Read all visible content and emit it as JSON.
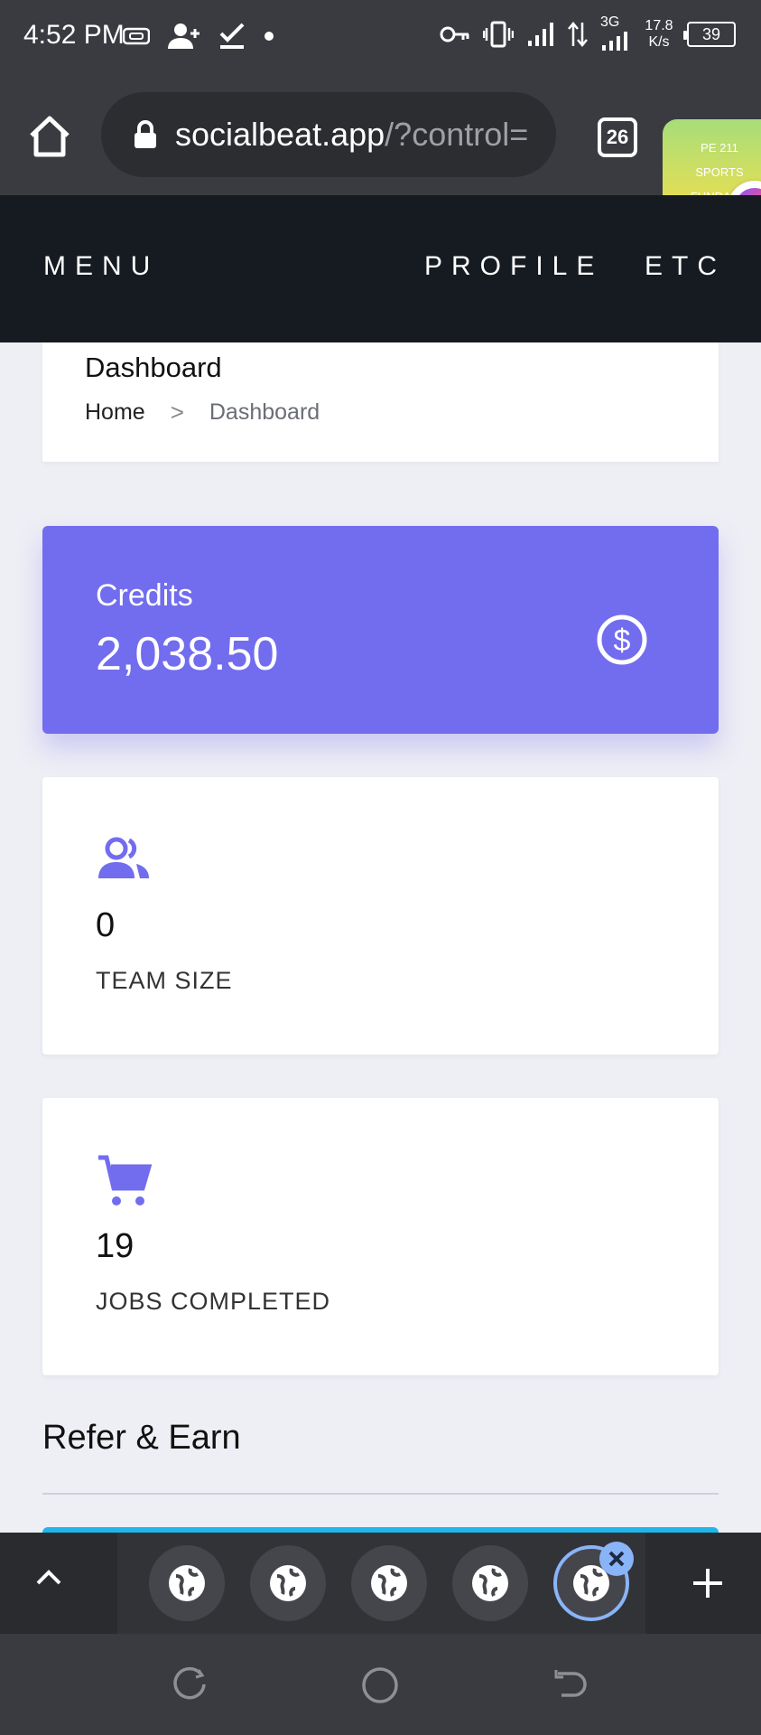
{
  "status_bar": {
    "time": "4:52 PM",
    "network_speed": "17.8 K/s",
    "network_type": "3G",
    "battery": "39",
    "icons": [
      "vr-icon",
      "add-person-icon",
      "check-icon",
      "dot-icon",
      "key-icon",
      "vibrate-icon",
      "signal-icon",
      "data-arrows-icon",
      "signal-3g-icon",
      "battery-icon"
    ]
  },
  "browser": {
    "url_domain": "socialbeat.app",
    "url_path": "/?control=",
    "tab_count": "26",
    "icons": [
      "home-icon",
      "lock-icon"
    ]
  },
  "sticky_note": {
    "lines": [
      "PE 211",
      "SPORTS",
      "FUNDAME"
    ]
  },
  "nav": {
    "menu": "MENU",
    "profile": "PROFILE",
    "etc": "ETC"
  },
  "page": {
    "title": "Dashboard",
    "breadcrumb": {
      "home": "Home",
      "separator": ">",
      "current": "Dashboard"
    }
  },
  "credits": {
    "label": "Credits",
    "value": "2,038.50",
    "icon": "dollar-circle-icon",
    "color": "#726cee"
  },
  "stats": {
    "team": {
      "value": "0",
      "label": "TEAM SIZE",
      "icon": "people-icon"
    },
    "jobs": {
      "value": "19",
      "label": "JOBS COMPLETED",
      "icon": "cart-icon"
    }
  },
  "refer": {
    "title": "Refer & Earn"
  },
  "tab_switcher": {
    "icons": [
      "chevron-up-icon",
      "globe-icon",
      "close-icon",
      "plus-icon"
    ]
  },
  "android_nav": {
    "icons": [
      "recents-icon",
      "home-circle-icon",
      "back-icon"
    ]
  }
}
